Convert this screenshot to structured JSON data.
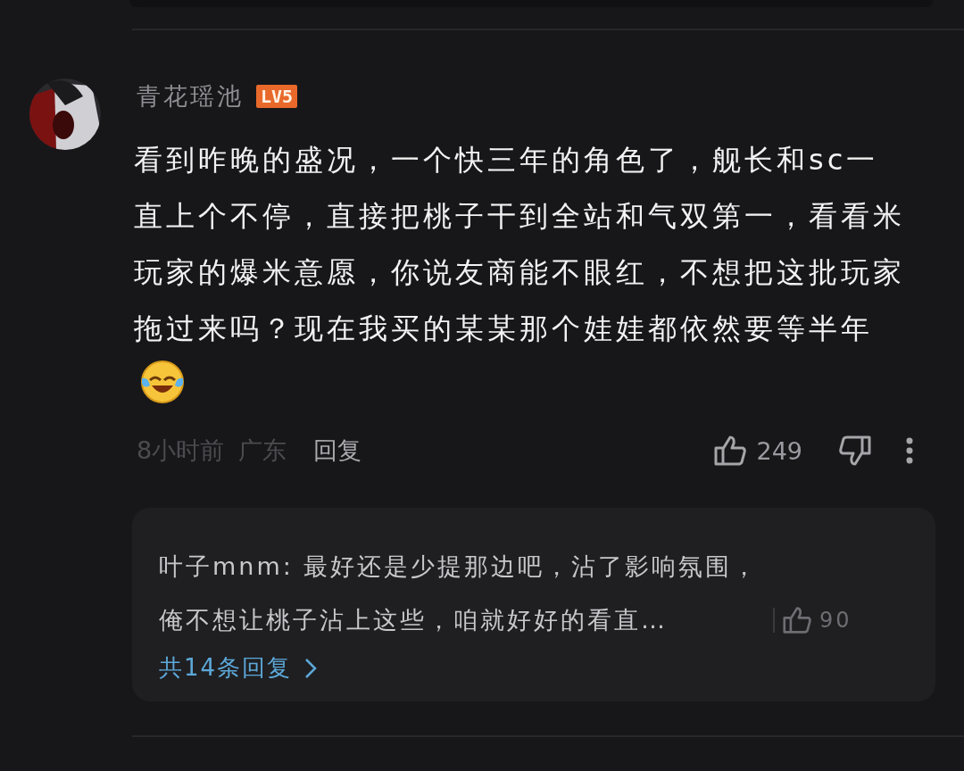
{
  "comment": {
    "user": {
      "name": "青花瑶池",
      "level": "LV5"
    },
    "text": "看到昨晚的盛况，一个快三年的角色了，舰长和sc一直上个不停，直接把桃子干到全站和气双第一，看看米玩家的爆米意愿，你说友商能不眼红，不想把这批玩家拖过来吗？现在我买的某某那个娃娃都依然要等半年",
    "time": "8小时前",
    "location": "广东",
    "reply_label": "回复",
    "likes": "249",
    "sub_reply": {
      "text": "叶子mnm: 最好还是少提那边吧，沾了影响氛围，俺不想让桃子沾上这些，咱就好好的看直…",
      "likes": "90"
    },
    "more_replies": "共14条回复"
  }
}
